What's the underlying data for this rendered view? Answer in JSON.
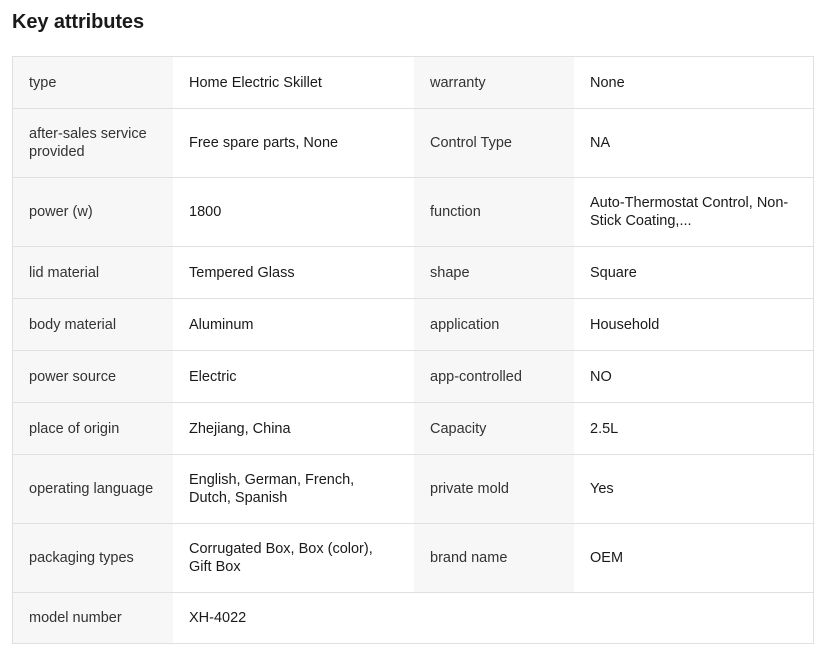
{
  "title": "Key attributes",
  "rows": [
    {
      "k1": "type",
      "v1": "Home Electric Skillet",
      "k2": "warranty",
      "v2": "None"
    },
    {
      "k1": "after-sales service provided",
      "v1": "Free spare parts, None",
      "k2": "Control Type",
      "v2": "NA"
    },
    {
      "k1": "power (w)",
      "v1": "1800",
      "k2": "function",
      "v2": "Auto-Thermostat Control, Non-Stick Coating,..."
    },
    {
      "k1": "lid material",
      "v1": "Tempered Glass",
      "k2": "shape",
      "v2": "Square"
    },
    {
      "k1": "body material",
      "v1": "Aluminum",
      "k2": "application",
      "v2": "Household"
    },
    {
      "k1": "power source",
      "v1": "Electric",
      "k2": "app-controlled",
      "v2": "NO"
    },
    {
      "k1": "place of origin",
      "v1": "Zhejiang, China",
      "k2": "Capacity",
      "v2": "2.5L"
    },
    {
      "k1": "operating language",
      "v1": "English, German, French, Dutch, Spanish",
      "k2": "private mold",
      "v2": "Yes"
    },
    {
      "k1": "packaging types",
      "v1": "Corrugated Box, Box (color), Gift Box",
      "k2": "brand name",
      "v2": "OEM"
    },
    {
      "k1": "model number",
      "v1": "XH-4022",
      "k2": "",
      "v2": ""
    }
  ]
}
